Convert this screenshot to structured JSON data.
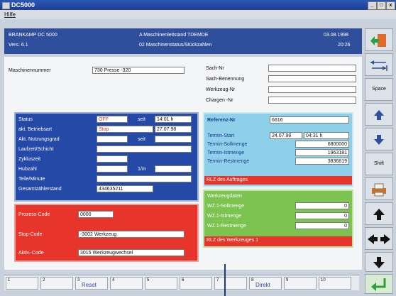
{
  "window": {
    "title": "DC5000",
    "min": "_",
    "max": "□",
    "close": "x"
  },
  "menu": {
    "help": "Hilfe"
  },
  "header": {
    "left_line1": "BRANKAMP DC 5000",
    "left_line2": "Vers. 6.1",
    "center_line1": "A Maschinenleitstand TDEMDE",
    "center_line2": "02 Maschinenstatus/Stückzahlen",
    "date": "03.08.1998",
    "time": "20:26"
  },
  "machine": {
    "label": "Maschinennummer",
    "value": "730 Presse -320"
  },
  "sach": {
    "nr": "Sach-Nr",
    "benennung": "Sach-Benennung",
    "werkzeug": "Werkzeug-Nr",
    "chargen": "Chargen -Nr"
  },
  "status": {
    "status_label": "Status",
    "status_value": "OFF",
    "seit1": "seit",
    "seit1_value": "14:01 h",
    "betriebsart_label": "akt. Betriebsart",
    "betriebsart_value": "Stop",
    "date_value": "27.07.98",
    "nutzung_label": "Akt. Nutzungsgrad",
    "seit2": "seit",
    "laufzeit_label": "Laufzeit/Schicht",
    "zyklus_label": "Zykluszeit",
    "hub_label": "Hubzahl",
    "min_label": "1/m",
    "teile_label": "Teile/Minute",
    "gesamt_label": "Gesamtzählerstand",
    "gesamt_value": "434635211"
  },
  "codes": {
    "prozess_label": "Prozess-Code",
    "prozess_value": "0000",
    "stop_label": "Stop-Code",
    "stop_value": "-3002 Werkzeug",
    "aktiv_label": "Aktiv.-Code",
    "aktiv_value": "3015 Werkzeugwechsel"
  },
  "auftrag": {
    "ref_label": "Referenz-Nr",
    "ref_value": "6616",
    "start_label": "Termin-Start",
    "start_date": "24.07.98",
    "start_time": "04:31 h",
    "soll_label": "Termin-Sollmenge",
    "soll_value": "6800000",
    "ist_label": "Termin-Istmenge",
    "ist_value": "1963181",
    "rest_label": "Termin-Restmenge",
    "rest_value": "3836819",
    "rlz": "RLZ des Auftrages"
  },
  "werkzeug": {
    "title": "Werkzeugdaten",
    "soll_label": "WZ.1-Sollmenge",
    "soll_value": "0",
    "ist_label": "WZ.1-Istmenge",
    "ist_value": "0",
    "rest_label": "WZ.1-Restmenge",
    "rest_value": "0",
    "rlz": "RLZ des Werkzeuges 1"
  },
  "right_toolbar": {
    "space": "Space",
    "shift": "Shift"
  },
  "fkeys": [
    {
      "n": "1",
      "t": ""
    },
    {
      "n": "2",
      "t": ""
    },
    {
      "n": "3",
      "t": "Reset"
    },
    {
      "n": "4",
      "t": ""
    },
    {
      "n": "5",
      "t": ""
    },
    {
      "n": "6",
      "t": ""
    },
    {
      "n": "7",
      "t": ""
    },
    {
      "n": "8",
      "t": "Direkt"
    },
    {
      "n": "9",
      "t": ""
    },
    {
      "n": "10",
      "t": ""
    }
  ],
  "colors": {
    "header": "#2f4f9c",
    "red": "#e8352c",
    "cyan": "#8ed0ea",
    "green": "#7cc34f",
    "accent": "#2549a6"
  }
}
